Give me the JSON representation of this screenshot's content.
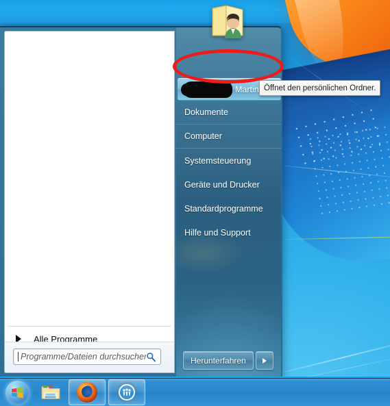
{
  "desktop": {
    "wallpaper_name": "windows7-default-wallpaper",
    "colors": {
      "sky_blue": "#2aa9e8",
      "deep_blue": "#1a5e9b",
      "flag_orange": "#f2690d",
      "flag_blue": "#1f6fc4",
      "accent_green": "#c4e260"
    }
  },
  "start_menu": {
    "left_pane": {
      "programs_list": [],
      "all_programs": {
        "label": "Alle Programme",
        "arrow_icon": "triangle-right-icon"
      },
      "search": {
        "value": "",
        "placeholder": "Programme/Dateien durchsuchen",
        "icon": "search-icon"
      }
    },
    "right_pane": {
      "avatar": {
        "icon": "user-folder-avatar-icon"
      },
      "items": [
        {
          "label": "Martin",
          "redacted_prefix": true,
          "active": true,
          "separator": false,
          "name": "user-folder"
        },
        {
          "label": "Dokumente",
          "redacted_prefix": false,
          "active": false,
          "separator": true,
          "name": "documents"
        },
        {
          "label": "Computer",
          "redacted_prefix": false,
          "active": false,
          "separator": true,
          "name": "computer"
        },
        {
          "label": "Systemsteuerung",
          "redacted_prefix": false,
          "active": false,
          "separator": false,
          "name": "control-panel"
        },
        {
          "label": "Geräte und Drucker",
          "redacted_prefix": false,
          "active": false,
          "separator": false,
          "name": "devices-and-printers"
        },
        {
          "label": "Standardprogramme",
          "redacted_prefix": false,
          "active": false,
          "separator": false,
          "name": "default-programs"
        },
        {
          "label": "Hilfe und Support",
          "redacted_prefix": false,
          "active": false,
          "separator": false,
          "name": "help-and-support"
        }
      ],
      "shutdown": {
        "label": "Herunterfahren",
        "arrow_icon": "triangle-right-icon"
      }
    }
  },
  "tooltip": {
    "text": "Öffnet den persönlichen Ordner."
  },
  "annotation": {
    "shape": "ellipse",
    "color": "#ee1b1b"
  },
  "taskbar": {
    "start_button": {
      "icon": "windows-orb-icon"
    },
    "items": [
      {
        "name": "explorer",
        "icon": "folder-explorer-icon",
        "pinned_frame": false
      },
      {
        "name": "firefox",
        "icon": "firefox-icon",
        "pinned_frame": true
      },
      {
        "name": "amp-app",
        "icon": "orange-circle-app-icon",
        "pinned_frame": true
      }
    ]
  }
}
